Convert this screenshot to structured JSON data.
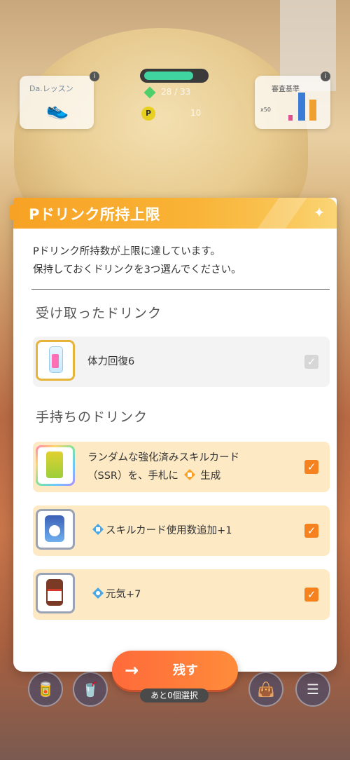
{
  "background": {
    "lesson_card_title": "Da.レッスン",
    "exam_card_title": "審査基準",
    "exam_card_scale": "x50",
    "hp_text": "28 / 33",
    "p_label": "P",
    "p_value": "10",
    "badge": "i"
  },
  "modal": {
    "title": "Pドリンク所持上限",
    "message_line1": "Pドリンク所持数が上限に達しています。",
    "message_line2": "保持しておくドリンクを3つ選んでください。",
    "received_section_title": "受け取ったドリンク",
    "held_section_title": "手持ちのドリンク",
    "received_items": [
      {
        "text": "体力回復6",
        "checked": true,
        "disabled": true
      }
    ],
    "held_items": [
      {
        "text_line1": "ランダムな強化済みスキルカード",
        "text_line2_prefix": "（SSR）を、手札に",
        "text_line2_suffix": "生成",
        "checked": true
      },
      {
        "text": "スキルカード使用数追加+1",
        "checked": true
      },
      {
        "text": "元気+7",
        "checked": true
      }
    ]
  },
  "buttons": {
    "keep_label": "残す",
    "remaining_text": "あと0個選択"
  },
  "icons": {
    "check": "✓",
    "arrow": "→",
    "sparkle": "✦"
  },
  "colors": {
    "accent_orange": "#f5821f",
    "header_yellow": "#f9b336",
    "held_row_bg": "#fde9c4"
  }
}
